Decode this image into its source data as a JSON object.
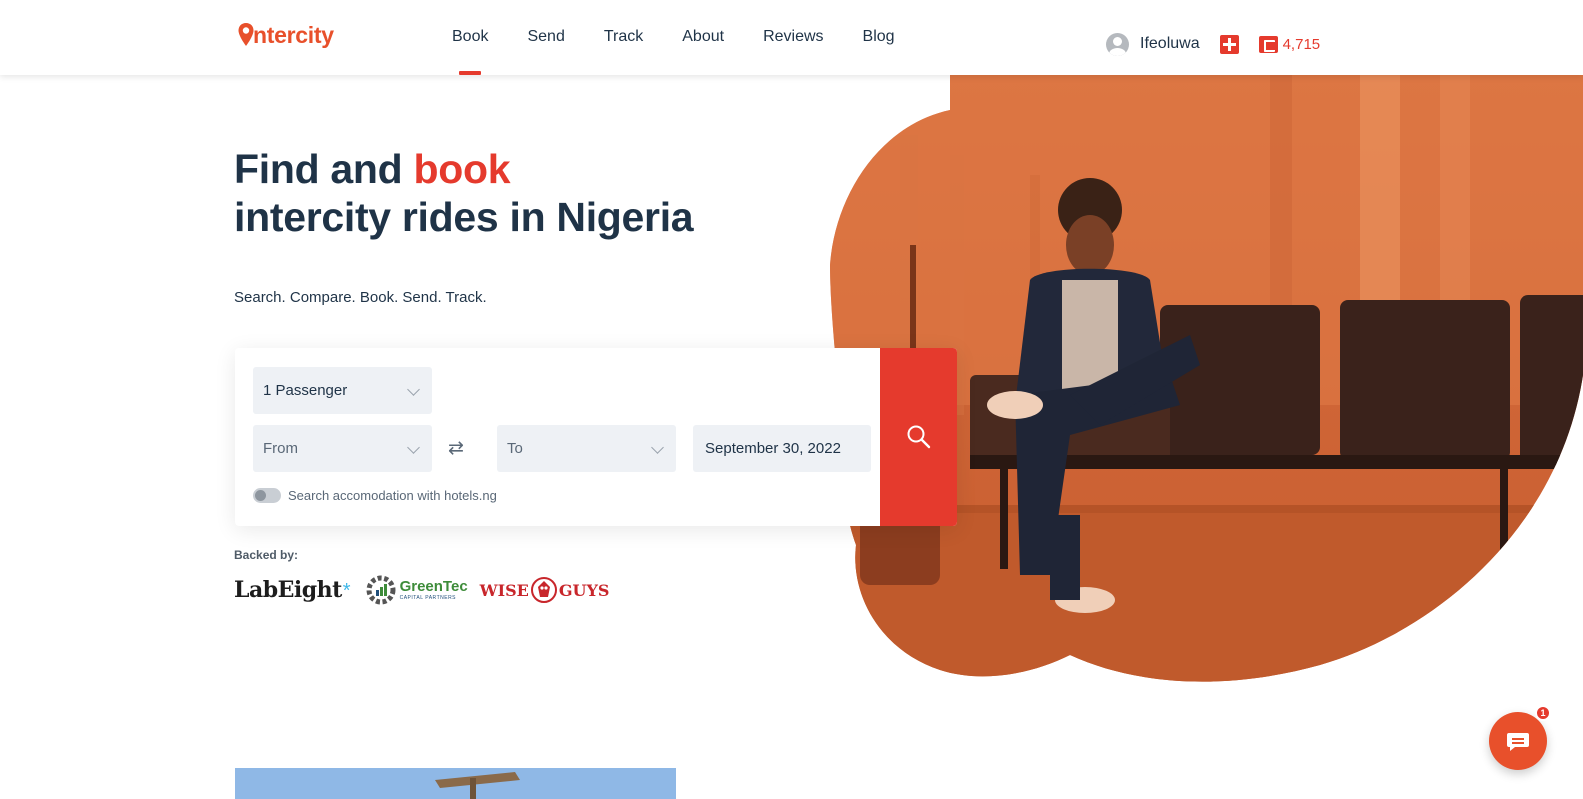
{
  "brand": {
    "logo_text": "ntercity",
    "accent_color": "#e53a2d"
  },
  "nav": {
    "items": [
      {
        "label": "Book",
        "active": true
      },
      {
        "label": "Send",
        "active": false
      },
      {
        "label": "Track",
        "active": false
      },
      {
        "label": "About",
        "active": false
      },
      {
        "label": "Reviews",
        "active": false
      },
      {
        "label": "Blog",
        "active": false
      }
    ]
  },
  "user": {
    "name": "Ifeoluwa",
    "wallet_balance": "4,715"
  },
  "hero": {
    "title_part1": "Find and ",
    "title_accent": "book",
    "title_part2": "intercity rides in Nigeria",
    "subtitle": "Search. Compare. Book. Send. Track."
  },
  "search": {
    "passengers": "1 Passenger",
    "from_placeholder": "From",
    "to_placeholder": "To",
    "date": "September 30, 2022",
    "hotels_toggle_label": "Search accomodation with hotels.ng",
    "hotels_toggle_on": false
  },
  "backers": {
    "label": "Backed by:",
    "logos": {
      "labeight": "LabEight",
      "labeight_star": "*",
      "greentec_name": "GreenTec",
      "greentec_sub": "CAPITAL PARTNERS",
      "wiseguys_left": "WISE",
      "wiseguys_right": "GUYS"
    }
  },
  "chat": {
    "unread_count": "1"
  }
}
